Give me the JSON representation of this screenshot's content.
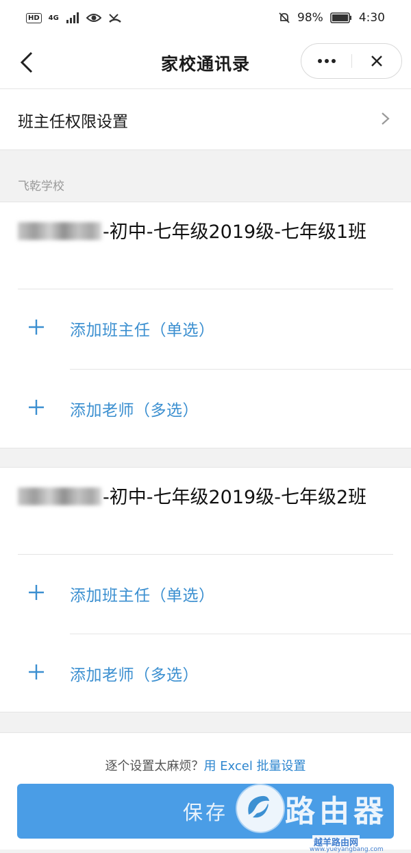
{
  "status_bar": {
    "hd": "HD",
    "network": "4G",
    "battery": "98%",
    "time": "4:30"
  },
  "nav": {
    "title": "家校通讯录",
    "more_icon": "ellipsis-icon",
    "close_icon": "close-icon",
    "back_icon": "chevron-left-icon"
  },
  "permission_row": {
    "label": "班主任权限设置"
  },
  "school": {
    "name": "飞乾学校"
  },
  "classes": [
    {
      "name": "-初中-七年级2019级-七年级1班",
      "add_head_teacher": "添加班主任（单选）",
      "add_teacher": "添加老师（多选）"
    },
    {
      "name": "-初中-七年级2019级-七年级2班",
      "add_head_teacher": "添加班主任（单选）",
      "add_teacher": "添加老师（多选）"
    }
  ],
  "footer": {
    "hint_prefix": "逐个设置太麻烦？",
    "hint_link": "用 Excel 批量设置",
    "save_label": "保存"
  },
  "watermark": {
    "text": "路由器",
    "sub": "越羊路由网",
    "url": "www.yueyangbang.com"
  },
  "colors": {
    "accent": "#3b8fd0",
    "button": "#4a9de6",
    "background": "#f2f2f2"
  }
}
